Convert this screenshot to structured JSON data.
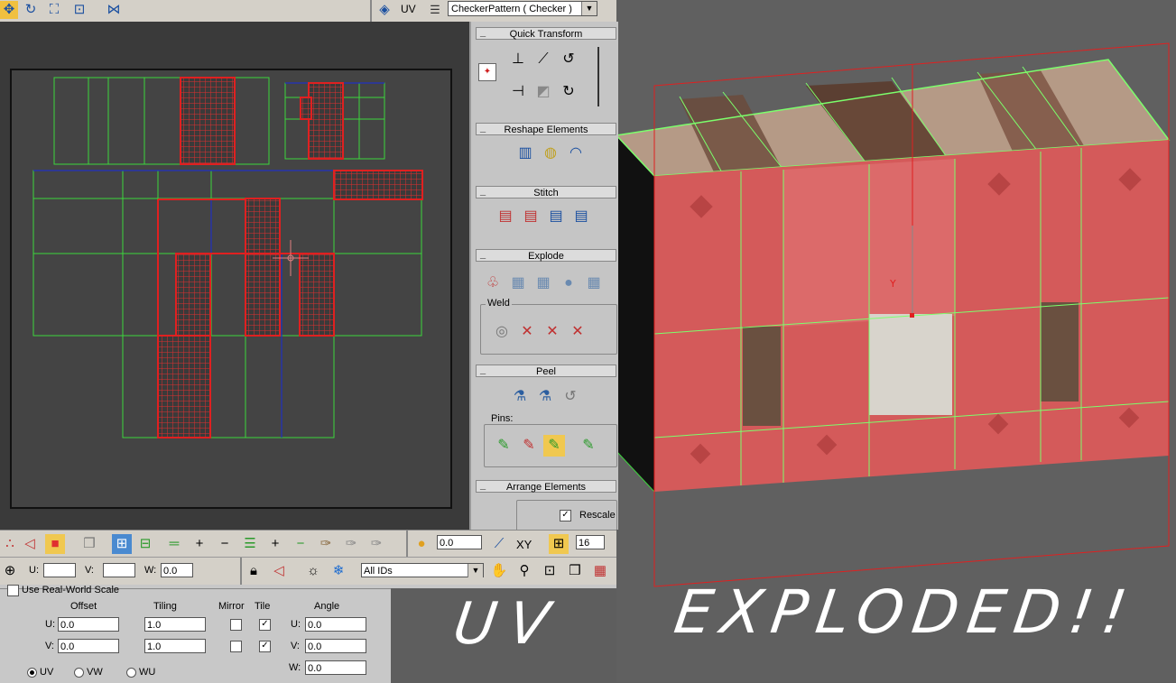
{
  "topbar": {
    "uv_label": "UV",
    "texture_value": "CheckerPattern  ( Checker )"
  },
  "rollouts": {
    "quick_transform": "Quick Transform",
    "reshape": "Reshape Elements",
    "stitch": "Stitch",
    "explode": "Explode",
    "weld": "Weld",
    "peel": "Peel",
    "pins": "Pins:",
    "arrange": "Arrange Elements",
    "rescale": "Rescale"
  },
  "toolbar1": {
    "rotate_value": "0.0",
    "xy_label": "XY",
    "grid_value": "16"
  },
  "toolbar2": {
    "u_label": "U:",
    "v_label": "V:",
    "w_label": "W:",
    "w_value": "0.0",
    "filter_value": "All IDs"
  },
  "params": {
    "real_world": "Use Real-World Scale",
    "offset": "Offset",
    "tiling": "Tiling",
    "mirror": "Mirror",
    "tile": "Tile",
    "angle": "Angle",
    "u_label": "U:",
    "v_label": "V:",
    "w_label": "W:",
    "offset_u": "0.0",
    "offset_v": "0.0",
    "tiling_u": "1.0",
    "tiling_v": "1.0",
    "angle_u": "0.0",
    "angle_v": "0.0",
    "angle_w": "0.0",
    "uv": "UV",
    "vw": "VW",
    "wu": "WU"
  },
  "viewport": {
    "handwriting_left": "UV",
    "handwriting_right": "EXPLODED!!"
  },
  "colors": {
    "uv_green": "#3cd63c",
    "uv_red": "#e02020",
    "uv_blue": "#2030c0",
    "brick": "#d45a5a"
  }
}
